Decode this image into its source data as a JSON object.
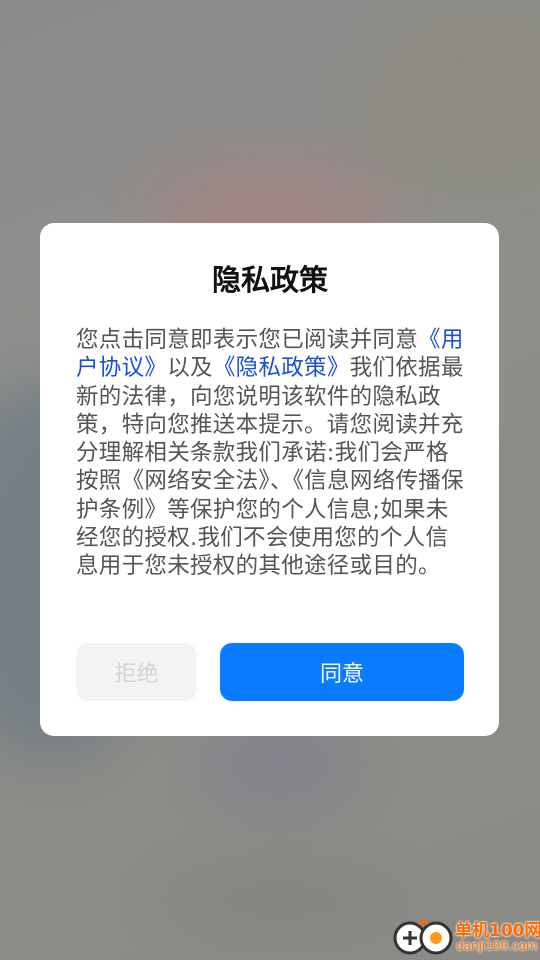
{
  "dialog": {
    "title": "隐私政策",
    "body": {
      "part1": "您点击同意即表示您已阅读并同意",
      "link_user_agreement": "《用户协议》",
      "part2": "以及",
      "link_privacy_policy": "《隐私政策》",
      "part3": "我们依据最新的法律，向您说明该软件的隐私政策，特向您推送本提示。请您阅读并充分理解相关条款我们承诺:我们会严格按照《网络安全法》、《信息网络传播保护条例》等保护您的个人信息;如果未经您的授权.我们不会使用您的个人信息用于您未授权的其他途径或目的。"
    },
    "refuse_label": "拒绝",
    "agree_label": "同意"
  },
  "watermark": {
    "site_name": "单机100网",
    "site_url": "danji100.com"
  },
  "colors": {
    "accent": "#0a7cff",
    "link": "#1a4fd6",
    "watermark": "#ff6a00"
  }
}
